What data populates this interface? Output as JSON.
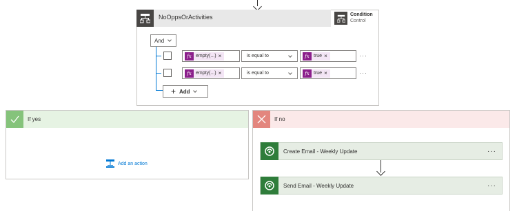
{
  "condition": {
    "title": "NoOppsOrActivities",
    "type_label": "Condition",
    "type_sub": "Control",
    "and_label": "And",
    "rows": [
      {
        "left_value": "empty(...)",
        "operator": "is equal to",
        "right_value": "true"
      },
      {
        "left_value": "empty(...)",
        "operator": "is equal to",
        "right_value": "true"
      }
    ],
    "add_label": "Add"
  },
  "if_yes": {
    "title": "If yes",
    "add_action_label": "Add an action"
  },
  "if_no": {
    "title": "If no",
    "actions": [
      {
        "title": "Create Email - Weekly Update"
      },
      {
        "title": "Send Email - Weekly Update"
      }
    ]
  },
  "icons": {
    "condition": "condition-icon",
    "yes": "checkmark-icon",
    "no": "close-icon",
    "dataverse": "dataverse-icon",
    "function": "fx-icon"
  },
  "colors": {
    "condition_header": "#e8e8e8",
    "condition_icon": "#484644",
    "fx_token": "#8b1f8b",
    "yes_header": "#e6f3e3",
    "yes_icon": "#85c37b",
    "no_header": "#fbe9e9",
    "no_icon": "#e3867e",
    "action_icon": "#2f7d3b",
    "link": "#0078d4"
  }
}
